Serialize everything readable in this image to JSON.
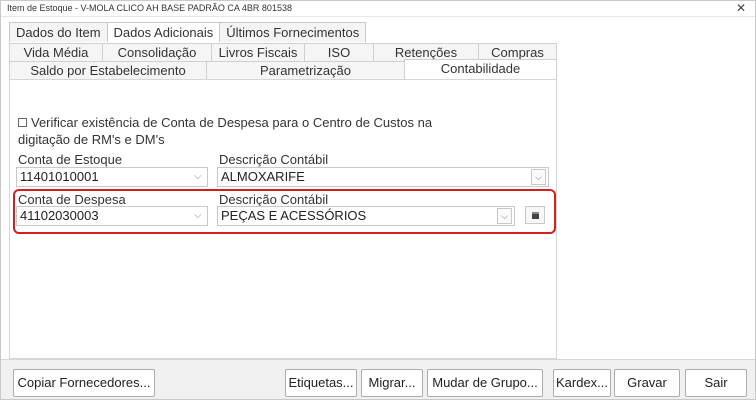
{
  "window": {
    "title": "Item de Estoque - V-MOLA CLICO AH BASE PADRÃO CA 4BR 801538",
    "close_glyph": "✕"
  },
  "main_tabs": [
    {
      "label": "Dados do Item",
      "active": false
    },
    {
      "label": "Dados Adicionais",
      "active": true
    },
    {
      "label": "Últimos Fornecimentos",
      "active": false
    }
  ],
  "sub_tabs_row1": [
    {
      "label": "Vida Média"
    },
    {
      "label": "Consolidação"
    },
    {
      "label": "Livros Fiscais"
    },
    {
      "label": "ISO"
    },
    {
      "label": "Retenções"
    },
    {
      "label": "Compras"
    }
  ],
  "sub_tabs_row2": [
    {
      "label": "Saldo por Estabelecimento",
      "active": false
    },
    {
      "label": "Parametrização",
      "active": false
    },
    {
      "label": "Contabilidade",
      "active": true
    }
  ],
  "contabilidade": {
    "checkbox_label": "Verificar existência de Conta de Despesa para o Centro de Custos na digitação de RM's e DM's",
    "checkbox_checked": false,
    "conta_estoque_label": "Conta de Estoque",
    "conta_estoque_value": "11401010001",
    "desc_contabil_label_1": "Descrição Contábil",
    "desc_contabil_value_1": "ALMOXARIFE",
    "conta_despesa_label": "Conta de Despesa",
    "conta_despesa_value": "41102030003",
    "desc_contabil_label_2": "Descrição Contábil",
    "desc_contabil_value_2": "PEÇAS E ACESSÓRIOS",
    "highlight_color": "#d41f1f"
  },
  "icons": {
    "chevron": "⌵",
    "dropdown": "⌵"
  },
  "buttons": {
    "copiar_fornecedores": "Copiar Fornecedores...",
    "etiquetas": "Etiquetas...",
    "migrar": "Migrar...",
    "mudar_grupo": "Mudar de Grupo...",
    "kardex": "Kardex...",
    "gravar": "Gravar",
    "sair": "Sair"
  }
}
